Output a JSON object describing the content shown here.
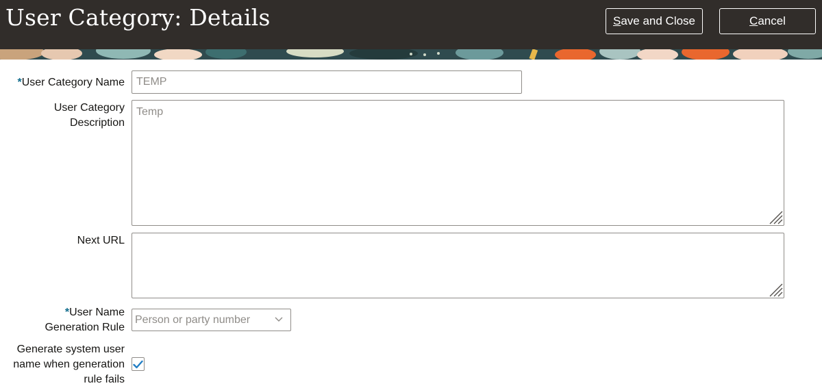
{
  "header": {
    "title": "User Category: Details",
    "save_close_first": "S",
    "save_close_rest": "ave and Close",
    "cancel_first": "C",
    "cancel_rest": "ancel"
  },
  "form": {
    "required_marker": "*",
    "name": {
      "label": "User Category Name",
      "value": "TEMP"
    },
    "description": {
      "label_line1": "User Category",
      "label_line2": "Description",
      "value": "Temp"
    },
    "next_url": {
      "label": "Next URL",
      "value": ""
    },
    "generation_rule": {
      "label_line1": "User Name",
      "label_line2": "Generation Rule",
      "selected": "Person or party number"
    },
    "generate_system_name": {
      "label_line1": "Generate system user",
      "label_line2": "name when generation",
      "label_line3": "rule fails",
      "checked": true
    }
  },
  "colors": {
    "header_bg": "#312d2a",
    "required": "#0f6b8c",
    "check": "#227ec4",
    "placeholder_text": "#8f8c88"
  },
  "icons": {
    "dropdown": "chevron-down-icon",
    "check": "check-icon",
    "resize": "resize-grip-icon"
  }
}
